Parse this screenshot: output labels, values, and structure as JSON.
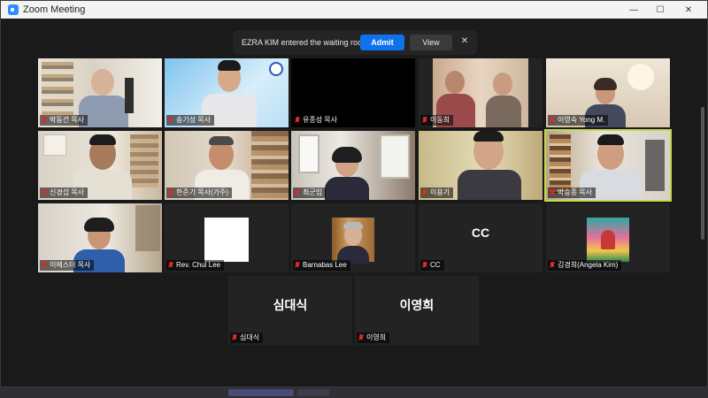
{
  "window": {
    "title": "Zoom Meeting",
    "controls": {
      "minimize": "—",
      "maximize": "☐",
      "close": "✕"
    }
  },
  "notification": {
    "text": "EZRA KIM entered the waiting room",
    "admit_label": "Admit",
    "view_label": "View",
    "dismiss_label": "✕"
  },
  "participants": [
    {
      "name": "박동건 목사",
      "muted": true
    },
    {
      "name": "송기성 목사",
      "muted": true
    },
    {
      "name": "유종성 목사",
      "muted": true
    },
    {
      "name": "이동희",
      "muted": true
    },
    {
      "name": "이영숙 Yong M.",
      "muted": true
    },
    {
      "name": "신경섭 목사",
      "muted": true
    },
    {
      "name": "한준기 목사(가주)",
      "muted": true
    },
    {
      "name": "최군임",
      "muted": true
    },
    {
      "name": "이용기",
      "muted": true
    },
    {
      "name": "박승종 목사",
      "muted": true,
      "speaking": true
    },
    {
      "name": "이에스더 목사",
      "muted": true
    },
    {
      "name": "Rev. Chul Lee",
      "muted": true
    },
    {
      "name": "Barnabas Lee",
      "muted": true
    },
    {
      "name": "CC",
      "muted": true,
      "display_text": "CC"
    },
    {
      "name": "김경희(Angela Kim)",
      "muted": true
    },
    {
      "name": "심대식",
      "muted": true,
      "display_text": "심대식"
    },
    {
      "name": "이영희",
      "muted": true,
      "display_text": "이영희"
    }
  ],
  "colors": {
    "speaking_border": "#c6d94a",
    "admit_button": "#0e72ed",
    "muted_icon": "#e02828"
  }
}
